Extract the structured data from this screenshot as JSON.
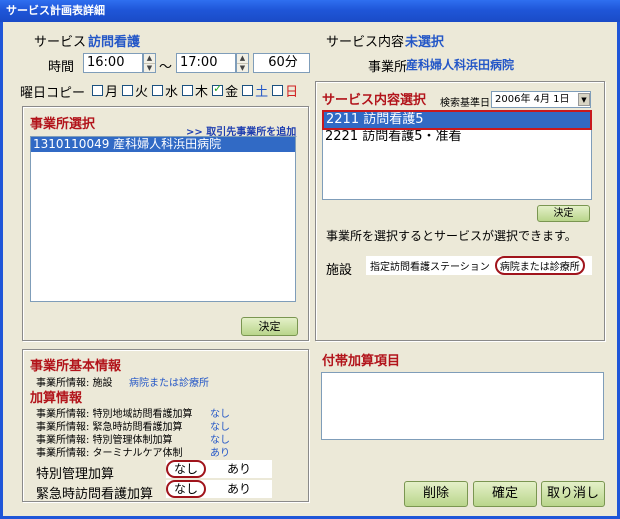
{
  "window": {
    "title": "サービス計画表詳細"
  },
  "service": {
    "label": "サービス",
    "value": "訪問看護",
    "content_label": "サービス内容",
    "content_value": "未選択"
  },
  "office": {
    "label": "事業所",
    "value": "産科婦人科浜田病院"
  },
  "time": {
    "label": "時間",
    "start": "16:00",
    "separator": "〜",
    "end": "17:00",
    "duration": "60分"
  },
  "weekday_copy": {
    "label": "曜日コピー",
    "days": [
      {
        "label": "月",
        "checked": false,
        "color": "#000000"
      },
      {
        "label": "火",
        "checked": false,
        "color": "#000000"
      },
      {
        "label": "水",
        "checked": false,
        "color": "#000000"
      },
      {
        "label": "木",
        "checked": false,
        "color": "#000000"
      },
      {
        "label": "金",
        "checked": true,
        "color": "#000000"
      },
      {
        "label": "土",
        "checked": false,
        "color": "#2457c7"
      },
      {
        "label": "日",
        "checked": false,
        "color": "#d02020"
      }
    ]
  },
  "office_select": {
    "title": "事業所選択",
    "link": ">> 取引先事業所を追加",
    "items": [
      "1310110049 産科婦人科浜田病院"
    ],
    "decide": "決定"
  },
  "service_select": {
    "title": "サービス内容選択",
    "date_label": "検索基準日",
    "date_value": "2006年 4月 1日",
    "items": [
      "2211 訪問看護5",
      "2221 訪問看護5・准看"
    ],
    "decide": "決定",
    "note": "事業所を選択するとサービスが選択できます。",
    "facility_label": "施設",
    "facility_type": "指定訪問看護ステーション",
    "facility_value": "病院または診療所"
  },
  "basic_info": {
    "title": "事業所基本情報",
    "facility_key": "事業所情報: 施設",
    "facility_val": "病院または診療所"
  },
  "addition_info": {
    "title": "加算情報",
    "rows": [
      {
        "key": "事業所情報: 特別地域訪問看護加算",
        "val": "なし"
      },
      {
        "key": "事業所情報: 緊急時訪問看護加算",
        "val": "なし"
      },
      {
        "key": "事業所情報: 特別管理体制加算",
        "val": "なし"
      },
      {
        "key": "事業所情報: ターミナルケア体制",
        "val": "あり"
      }
    ],
    "options": [
      {
        "label": "特別管理加算",
        "no": "なし",
        "yes": "あり"
      },
      {
        "label": "緊急時訪問看護加算",
        "no": "なし",
        "yes": "あり"
      }
    ]
  },
  "extra": {
    "title": "付帯加算項目"
  },
  "buttons": {
    "delete": "削除",
    "confirm": "確定",
    "cancel": "取り消し"
  }
}
